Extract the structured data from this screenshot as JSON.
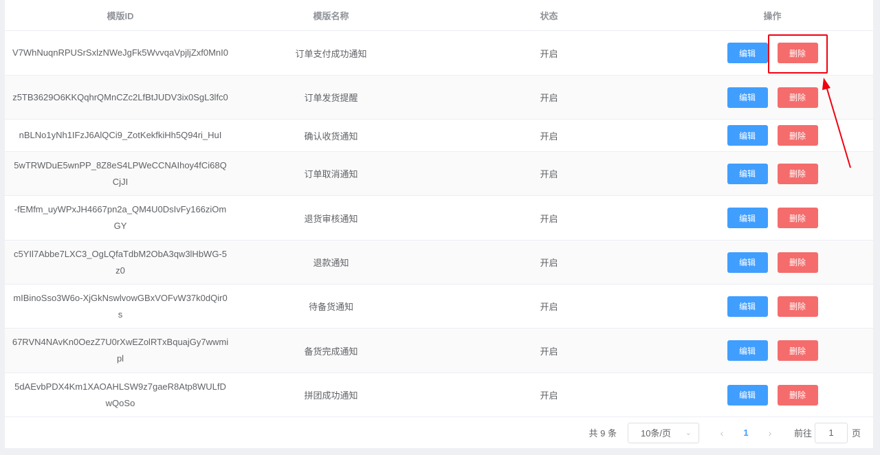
{
  "table": {
    "columns": [
      "模版ID",
      "模版名称",
      "状态",
      "操作"
    ],
    "edit_label": "编辑",
    "delete_label": "删除",
    "rows": [
      {
        "id": "V7WhNuqnRPUSrSxlzNWeJgFk5WvvqaVpjljZxf0MnI0",
        "name": "订单支付成功通知",
        "status": "开启"
      },
      {
        "id": "z5TB3629O6KKQqhrQMnCZc2LfBtJUDV3ix0SgL3lfc0",
        "name": "订单发货提醒",
        "status": "开启"
      },
      {
        "id": "nBLNo1yNh1IFzJ6AlQCi9_ZotKekfkiHh5Q94ri_HuI",
        "name": "确认收货通知",
        "status": "开启"
      },
      {
        "id": "5wTRWDuE5wnPP_8Z8eS4LPWeCCNAIhoy4fCi68QCjJI",
        "name": "订单取消通知",
        "status": "开启"
      },
      {
        "id": "-fEMfm_uyWPxJH4667pn2a_QM4U0DsIvFy166ziOmGY",
        "name": "退货审核通知",
        "status": "开启"
      },
      {
        "id": "c5YIl7Abbe7LXC3_OgLQfaTdbM2ObA3qw3lHbWG-5z0",
        "name": "退款通知",
        "status": "开启"
      },
      {
        "id": "mIBinoSso3W6o-XjGkNswlvowGBxVOFvW37k0dQir0s",
        "name": "待备货通知",
        "status": "开启"
      },
      {
        "id": "67RVN4NAvKn0OezZ7U0rXwEZolRTxBquajGy7wwmipl",
        "name": "备货完成通知",
        "status": "开启"
      },
      {
        "id": "5dAEvbPDX4Km1XAOAHLSW9z7gaeR8Atp8WULfDwQoSo",
        "name": "拼团成功通知",
        "status": "开启"
      }
    ]
  },
  "pagination": {
    "total": "共 9 条",
    "page_size": "10条/页",
    "current_page": "1",
    "goto_prefix": "前往",
    "goto_value": "1",
    "goto_suffix": "页",
    "prev_icon": "chevron-left-icon",
    "next_icon": "chevron-right-icon"
  },
  "colors": {
    "primary": "#409eff",
    "danger": "#f56c6c",
    "annotation": "#f0000f"
  }
}
